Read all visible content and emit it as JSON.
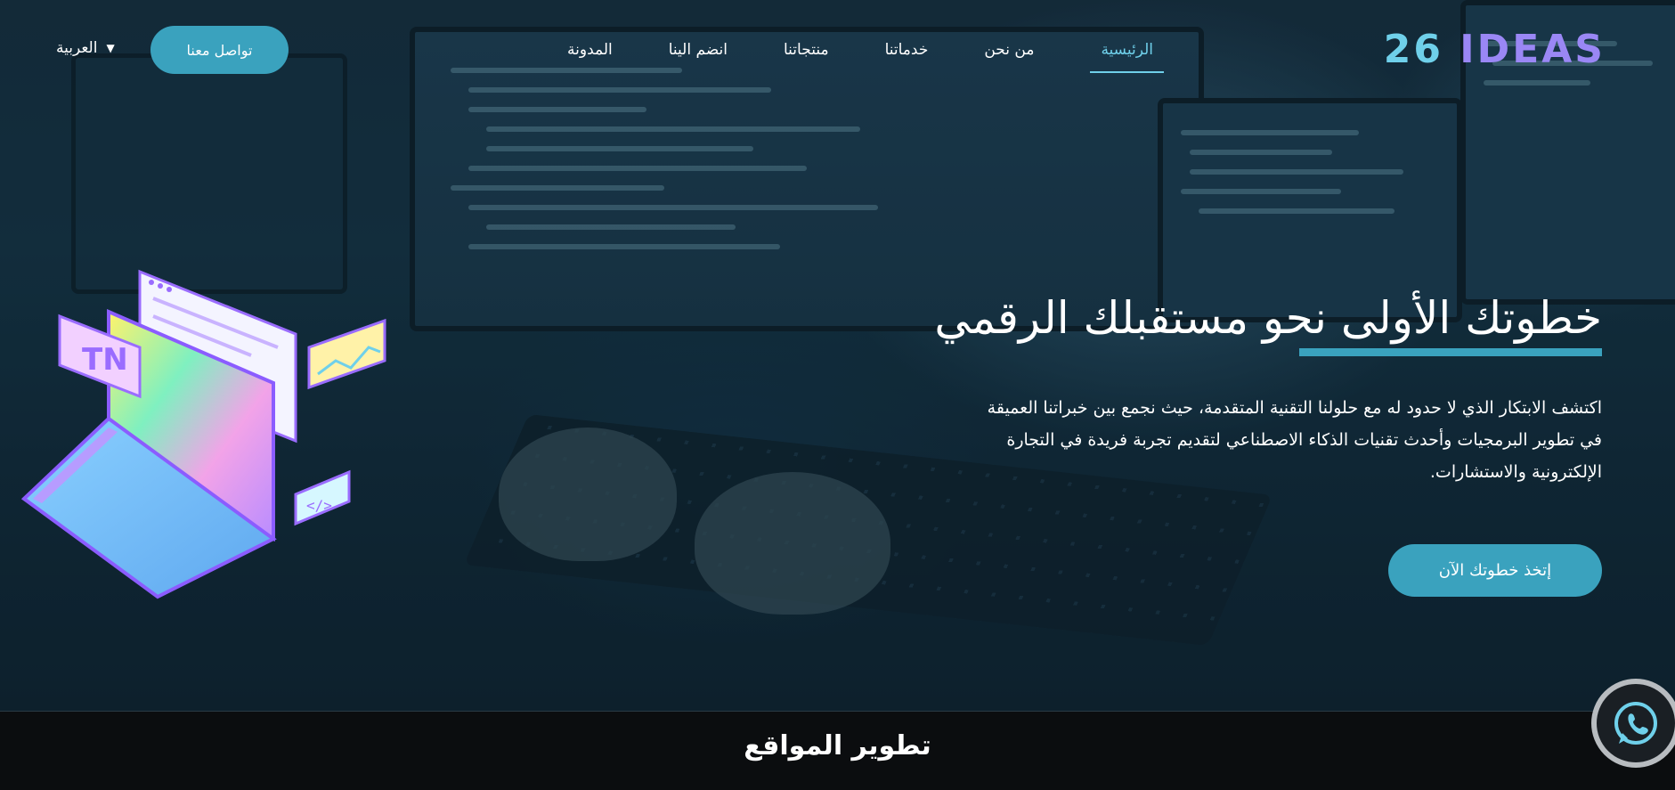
{
  "brand": {
    "logo_text": "26 IDEAS"
  },
  "nav": {
    "items": [
      {
        "label": "الرئيسية",
        "active": true
      },
      {
        "label": "من نحن"
      },
      {
        "label": "خدماتنا"
      },
      {
        "label": "منتجاتنا"
      },
      {
        "label": "انضم الينا"
      },
      {
        "label": "المدونة"
      }
    ],
    "contact_label": "تواصل معنا",
    "language_label": "العربية",
    "language_caret": "▼"
  },
  "hero": {
    "headline": "خطوتك الأولى نحو مستقبلك الرقمي",
    "description": "اكتشف الابتكار الذي لا حدود له مع حلولنا التقنية المتقدمة، حيث نجمع بين خبراتنا العميقة في تطوير البرمجيات وأحدث تقنيات الذكاء الاصطناعي لتقديم تجربة فريدة في التجارة الإلكترونية والاستشارات.",
    "cta_label": "إتخذ خطوتك الآن"
  },
  "section": {
    "title": "تطوير المواقع"
  },
  "icons": {
    "whatsapp": "whatsapp-icon",
    "caret": "chevron-down-icon"
  },
  "colors": {
    "accent": "#3aa2be",
    "active_link": "#6fd0ea",
    "logo_purple": "#9a87f5",
    "bottom_bar": "#0b0d0f"
  }
}
